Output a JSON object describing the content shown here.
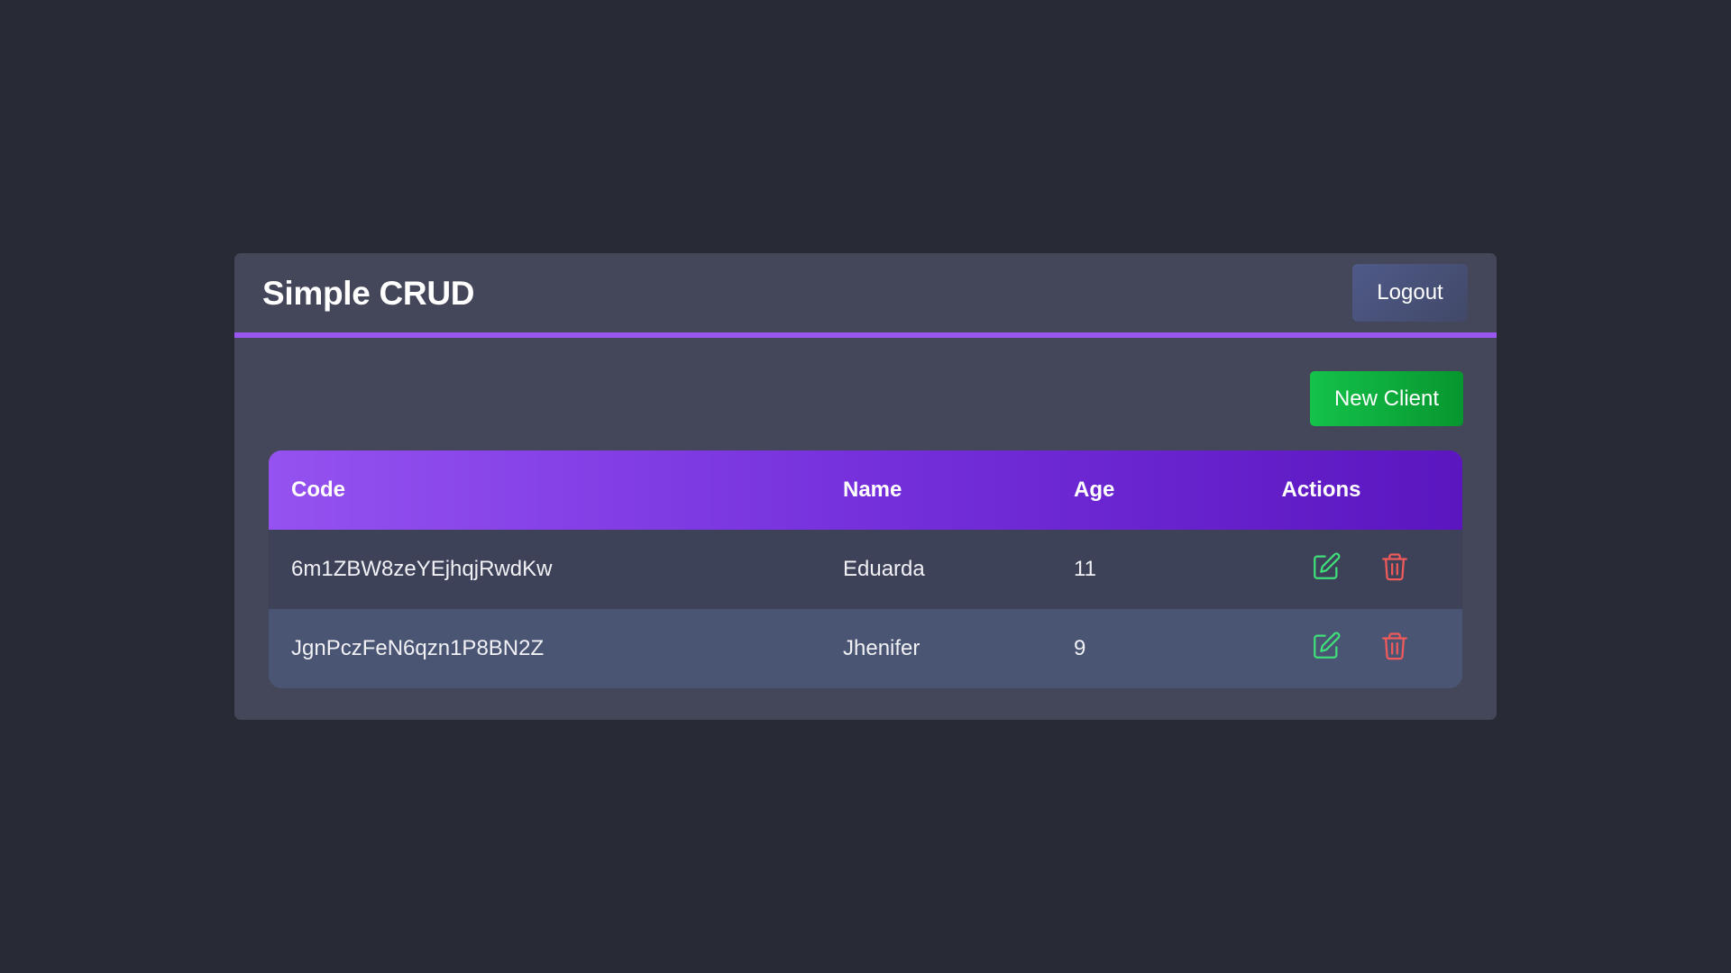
{
  "header": {
    "title": "Simple CRUD",
    "logout_label": "Logout"
  },
  "toolbar": {
    "new_client_label": "New Client"
  },
  "table": {
    "columns": [
      "Code",
      "Name",
      "Age",
      "Actions"
    ],
    "rows": [
      {
        "code": "6m1ZBW8zeYEjhqjRwdKw",
        "name": "Eduarda",
        "age": "11"
      },
      {
        "code": "JgnPczFeN6qzn1P8BN2Z",
        "name": "Jhenifer",
        "age": "9"
      }
    ]
  },
  "icons": {
    "edit": "edit-icon",
    "delete": "trash-icon"
  },
  "colors": {
    "background": "#282a36",
    "card": "#44475a",
    "accent": "#9a56f0",
    "primary_button": "#14c24a",
    "edit_icon": "#3fe07a",
    "delete_icon": "#f05a5a"
  }
}
